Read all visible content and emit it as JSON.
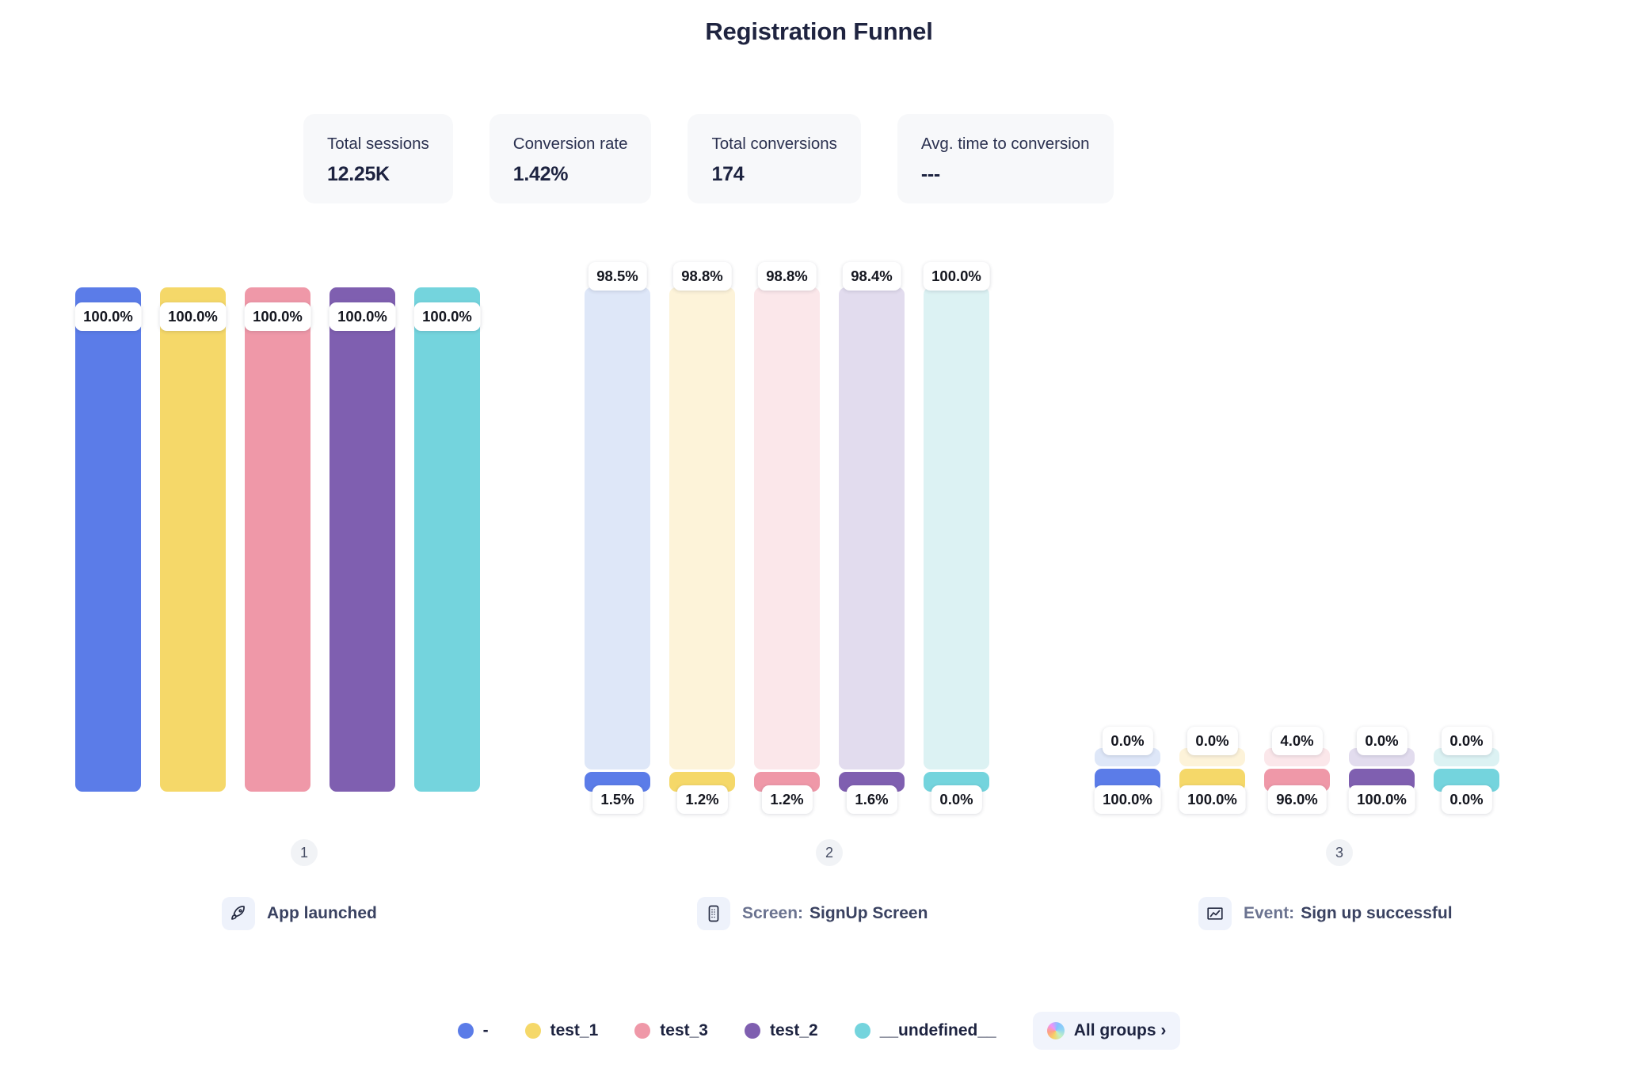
{
  "header": {
    "title": "Registration Funnel"
  },
  "stats": [
    {
      "label": "Total sessions",
      "value": "12.25K"
    },
    {
      "label": "Conversion rate",
      "value": "1.42%"
    },
    {
      "label": "Total conversions",
      "value": "174"
    },
    {
      "label": "Avg. time to conversion",
      "value": "---"
    }
  ],
  "legend": {
    "items": [
      {
        "label": "-",
        "color": "#5b7ce8"
      },
      {
        "label": "test_1",
        "color": "#f5d869"
      },
      {
        "label": "test_3",
        "color": "#ef98a8"
      },
      {
        "label": "test_2",
        "color": "#7f5fb0"
      },
      {
        "label": "__undefined__",
        "color": "#74d4dd"
      }
    ],
    "all_groups_label": "All groups ›"
  },
  "steps": [
    {
      "number": "1",
      "kind": "",
      "name": "App launched",
      "icon": "rocket-icon"
    },
    {
      "number": "2",
      "kind": "Screen:",
      "name": "SignUp Screen",
      "icon": "mobile-screen-icon"
    },
    {
      "number": "3",
      "kind": "Event:",
      "name": "Sign up successful",
      "icon": "chart-line-icon"
    }
  ],
  "chart_data": {
    "type": "bar",
    "title": "Registration Funnel",
    "subtype": "funnel-grouped-bar",
    "xlabel": "",
    "ylabel": "",
    "ylim": [
      0,
      100
    ],
    "grid": false,
    "legend_position": "bottom",
    "categories": [
      "1 – App launched",
      "2 – Screen: SignUp Screen",
      "3 – Event: Sign up successful"
    ],
    "series": [
      {
        "name": "-",
        "color": "#5b7ce8",
        "pale_color": "#dee7f8",
        "values": [
          100.0,
          1.5,
          0.0
        ],
        "top_labels": [
          "100.0%",
          "98.5%",
          "0.0%"
        ],
        "bottom_labels": [
          null,
          "1.5%",
          "100.0%"
        ],
        "drop_pct": [
          null,
          98.5,
          0.0
        ]
      },
      {
        "name": "test_1",
        "color": "#f5d869",
        "pale_color": "#fdf3d9",
        "values": [
          100.0,
          1.2,
          0.0
        ],
        "top_labels": [
          "100.0%",
          "98.8%",
          "0.0%"
        ],
        "bottom_labels": [
          null,
          "1.2%",
          "100.0%"
        ],
        "drop_pct": [
          null,
          98.8,
          0.0
        ]
      },
      {
        "name": "test_3",
        "color": "#ef98a8",
        "pale_color": "#fbe7ea",
        "values": [
          100.0,
          1.2,
          4.0
        ],
        "top_labels": [
          "100.0%",
          "98.8%",
          "4.0%"
        ],
        "bottom_labels": [
          null,
          "1.2%",
          "96.0%"
        ],
        "drop_pct": [
          null,
          98.8,
          4.0
        ]
      },
      {
        "name": "test_2",
        "color": "#7f5fb0",
        "pale_color": "#e2dcee",
        "values": [
          100.0,
          1.6,
          0.0
        ],
        "top_labels": [
          "100.0%",
          "98.4%",
          "0.0%"
        ],
        "bottom_labels": [
          null,
          "1.6%",
          "100.0%"
        ],
        "drop_pct": [
          null,
          98.4,
          0.0
        ]
      },
      {
        "name": "__undefined__",
        "color": "#74d4dd",
        "pale_color": "#dcf2f3",
        "values": [
          100.0,
          0.0,
          0.0
        ],
        "top_labels": [
          "100.0%",
          "100.0%",
          "0.0%"
        ],
        "bottom_labels": [
          null,
          "0.0%",
          "0.0%"
        ],
        "drop_pct": [
          null,
          100.0,
          0.0
        ]
      }
    ]
  }
}
